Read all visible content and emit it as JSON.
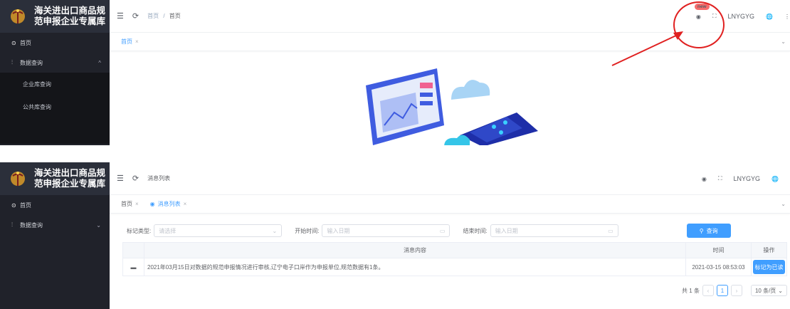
{
  "app": {
    "title_line1": "海关进出口商品规",
    "title_line2": "范申报企业专属库",
    "alt_title_line2": "范申报企业专属库"
  },
  "top": {
    "menu": [
      {
        "icon": "⊙",
        "label": "首页"
      },
      {
        "icon": "⫶",
        "label": "数据查询",
        "arrow": "^"
      }
    ],
    "submenu": [
      "企业库查询",
      "公共库查询"
    ],
    "breadcrumb": {
      "home": "首页",
      "sep": "/",
      "current": "首页"
    },
    "user": "LNYGYG",
    "badge": "new",
    "tab": {
      "label": "首页"
    }
  },
  "bottom": {
    "menu": [
      {
        "icon": "⊙",
        "label": "首页"
      },
      {
        "icon": "⫶",
        "label": "数据查询",
        "arrow": "⌄"
      }
    ],
    "breadcrumb": {
      "current": "消息列表"
    },
    "user": "LNYGYG",
    "tabs": [
      {
        "label": "首页"
      },
      {
        "label": "消息列表"
      }
    ],
    "filters": {
      "type_label": "标记类型:",
      "type_placeholder": "请选择",
      "start_label": "开始时间:",
      "start_placeholder": "输入日期",
      "end_label": "结束时间:",
      "end_placeholder": "输入日期",
      "query_button": "查询"
    },
    "table": {
      "headers": [
        "消息内容",
        "时间",
        "操作"
      ],
      "rows": [
        {
          "content": "2021年03月15日对数据的规范申报情况进行审核,辽宁电子口岸作为申报单位,规范数据有1条。",
          "time": "2021-03-15 08:53:03",
          "action": "标记为已读"
        }
      ]
    },
    "pagination": {
      "total": "共 1 条",
      "page": "1",
      "size": "10 条/页"
    }
  },
  "colors": {
    "sidebar": "#20222a",
    "accent": "#409eff",
    "annotation": "#e02020"
  }
}
